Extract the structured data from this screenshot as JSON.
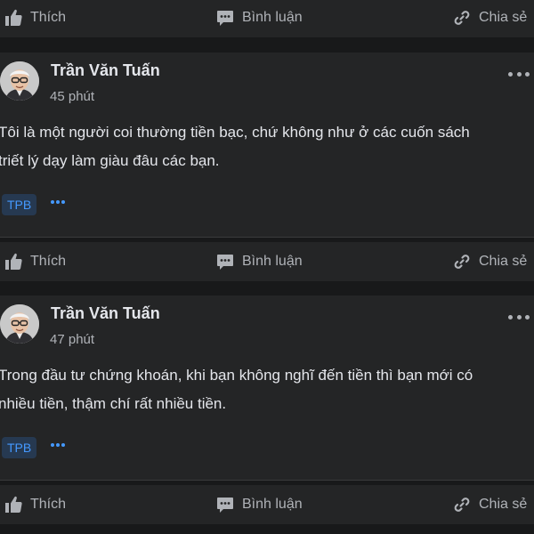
{
  "actions": {
    "like_label": "Thích",
    "comment_label": "Bình luận",
    "share_label": "Chia sẻ",
    "like_icon": "thumbs-up-icon",
    "comment_icon": "comment-icon",
    "share_icon": "link-share-icon"
  },
  "posts": [
    {
      "author": "Trần Văn Tuấn",
      "time": "45 phút",
      "text_lines": [
        "Tôi là một người coi thường tiền bạc, chứ không như ở các cuốn sách",
        "triết lý dạy làm giàu đâu các bạn."
      ],
      "tag": "TPB"
    },
    {
      "author": "Trần Văn Tuấn",
      "time": "47 phút",
      "text_lines": [
        "Trong đầu tư chứng khoán, khi bạn không nghĩ đến tiền thì bạn mới có",
        "nhiều tiền, thậm chí rất nhiều tiền."
      ],
      "tag": "TPB"
    }
  ],
  "colors": {
    "background": "#18191a",
    "card": "#242526",
    "text_primary": "#e4e6eb",
    "text_secondary": "#b0b3b8",
    "tag_background": "#263951",
    "tag_text": "#4599ff"
  }
}
